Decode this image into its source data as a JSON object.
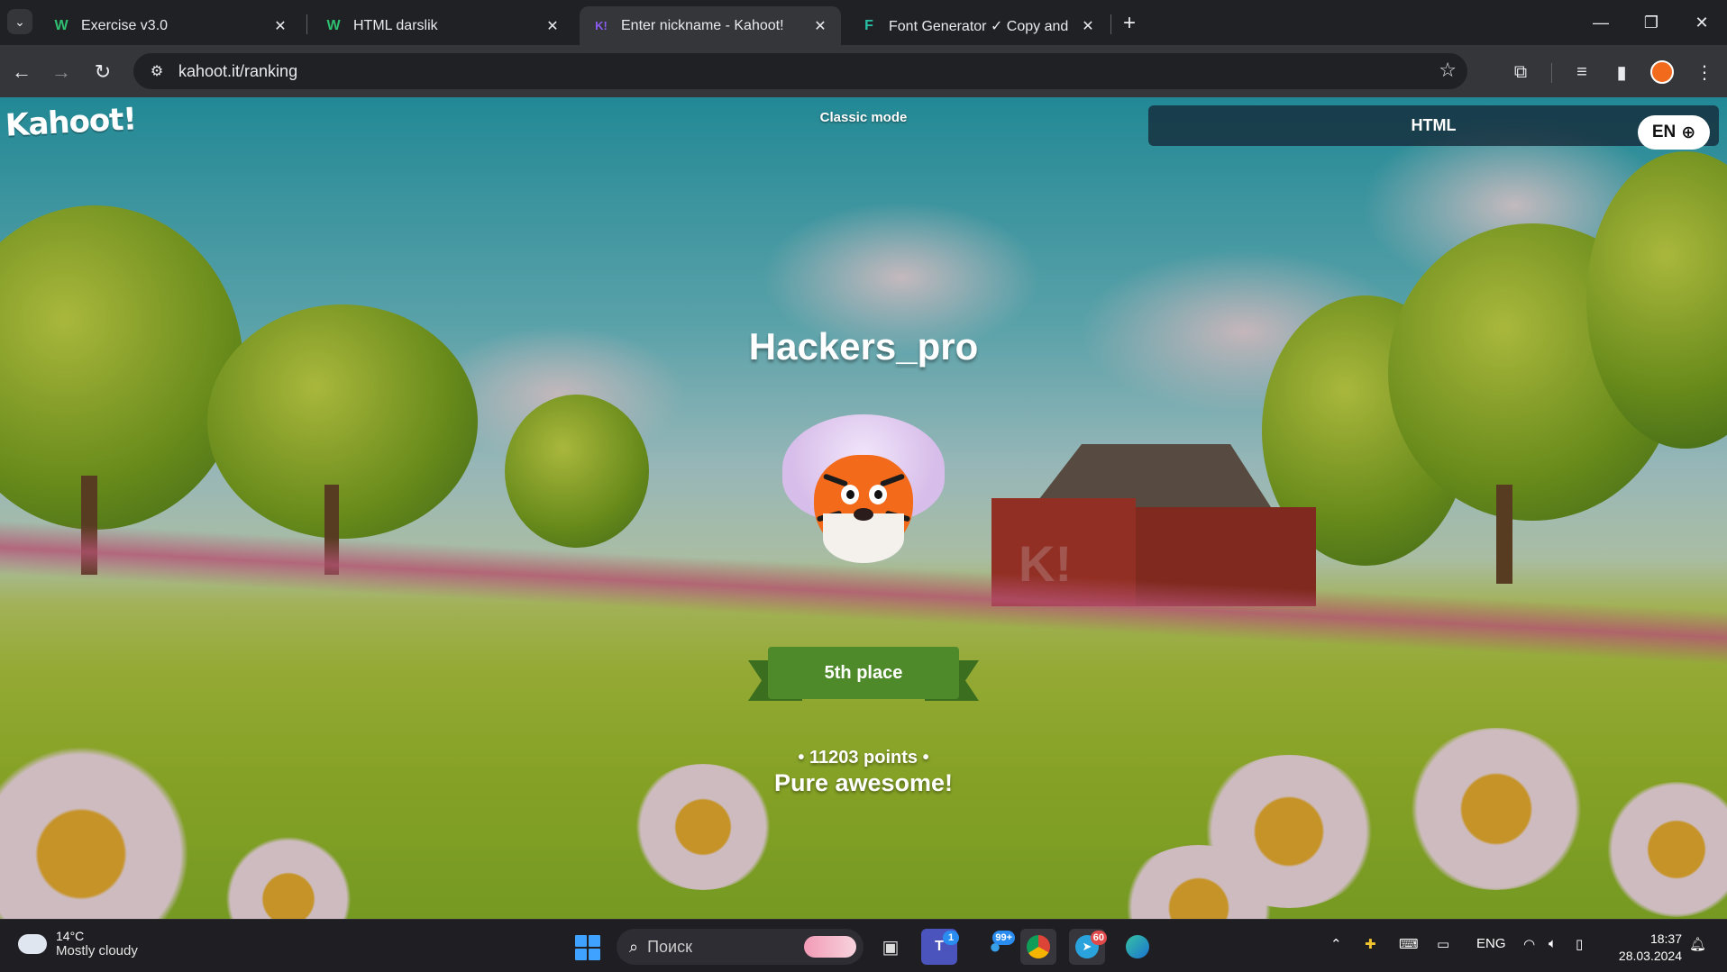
{
  "browser": {
    "tabs": [
      {
        "title": "Exercise v3.0",
        "favicon": "W",
        "favicon_color": "#2fbf71",
        "active": false
      },
      {
        "title": "HTML darslik",
        "favicon": "W",
        "favicon_color": "#2fbf71",
        "active": false
      },
      {
        "title": "Enter nickname - Kahoot!",
        "favicon": "K!",
        "favicon_color": "#46178f",
        "active": true
      },
      {
        "title": "Font Generator ✓ Copy and Pa",
        "favicon": "F",
        "favicon_color": "#27c2a7",
        "active": false
      }
    ],
    "url": "kahoot.it/ranking"
  },
  "kahoot": {
    "logo": "Kahoot!",
    "mode": "Classic mode",
    "nickname": "HTML",
    "language": "EN",
    "player_name": "Hackers_pro",
    "place": "5th place",
    "points": "• 11203 points •",
    "praise": "Pure awesome!"
  },
  "taskbar": {
    "weather_temp": "14°C",
    "weather_condition": "Mostly cloudy",
    "search_placeholder": "Поиск",
    "teams_badge": "1",
    "chat_badge": "99+",
    "telegram_badge": "60",
    "language": "ENG",
    "time": "18:37",
    "date": "28.03.2024"
  },
  "colors": {
    "kahoot_purple": "#46178f",
    "ribbon_green": "#4f8a2a",
    "tiger_orange": "#f36b1a"
  }
}
